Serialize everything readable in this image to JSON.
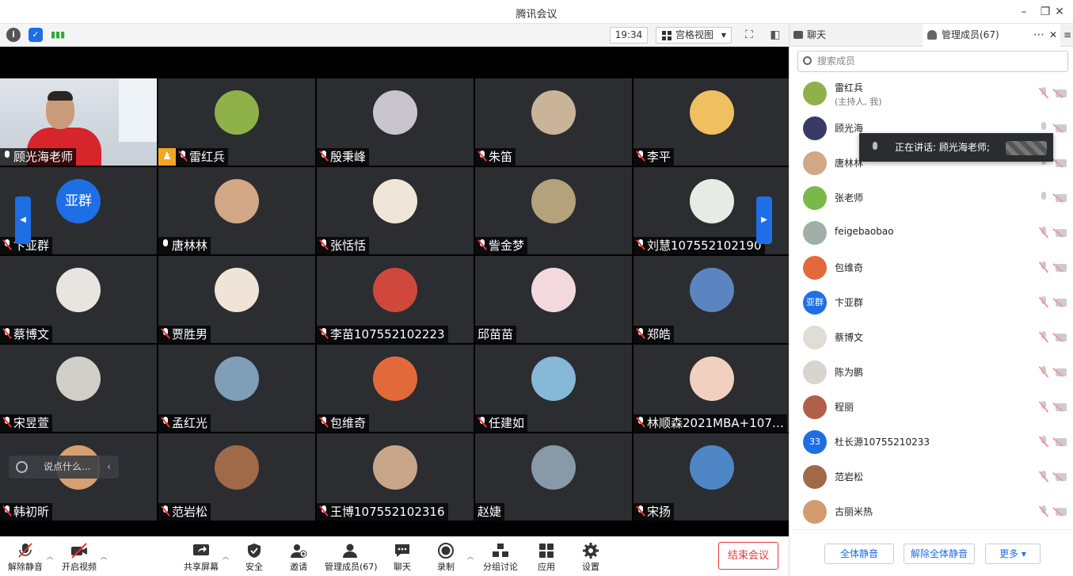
{
  "window": {
    "title": "腾讯会议"
  },
  "toolbar": {
    "clock": "19:34",
    "view_label": "宫格视图"
  },
  "panel": {
    "tab_chat": "聊天",
    "tab_members": "管理成员(67)",
    "search_placeholder": "搜索成员",
    "mute_all": "全体静音",
    "unmute_all": "解除全体静音",
    "more": "更多",
    "speaking": "正在讲话: 顾光海老师;"
  },
  "tiles": [
    {
      "name": "顾光海老师",
      "mic": "on"
    },
    {
      "name": "雷红兵",
      "mic": "muted",
      "host": true,
      "color": "#8fb14a"
    },
    {
      "name": "殷秉峰",
      "mic": "muted",
      "color": "#c8c5cf"
    },
    {
      "name": "朱笛",
      "mic": "muted",
      "color": "#c9b49a"
    },
    {
      "name": "李平",
      "mic": "muted",
      "color": "#f0c060"
    },
    {
      "name": "卞亚群",
      "mic": "muted",
      "avatar_text": "亚群",
      "color": "#1e6ee6"
    },
    {
      "name": "唐林林",
      "mic": "on",
      "color": "#d1a785"
    },
    {
      "name": "张恬恬",
      "mic": "muted",
      "color": "#f0e6d8"
    },
    {
      "name": "訾金梦",
      "mic": "muted",
      "color": "#b4a27c"
    },
    {
      "name": "刘慧107552102190",
      "mic": "muted",
      "color": "#e6ebe6"
    },
    {
      "name": "蔡博文",
      "mic": "muted",
      "color": "#e8e4e0"
    },
    {
      "name": "贾胜男",
      "mic": "muted",
      "color": "#efe4d6"
    },
    {
      "name": "李苗107552102223",
      "mic": "muted",
      "color": "#d0483c"
    },
    {
      "name": "邱苗苗",
      "mic": "none",
      "color": "#f3d9dd"
    },
    {
      "name": "郑皓",
      "mic": "muted",
      "color": "#5c84c0"
    },
    {
      "name": "宋昱萱",
      "mic": "muted",
      "color": "#cfcfc8"
    },
    {
      "name": "孟红光",
      "mic": "muted",
      "color": "#7f9fb8"
    },
    {
      "name": "包维奇",
      "mic": "muted",
      "color": "#e26a3a"
    },
    {
      "name": "任建如",
      "mic": "muted",
      "color": "#86b8d8"
    },
    {
      "name": "林顺森2021MBA+107…",
      "mic": "muted",
      "color": "#f2d0c0"
    },
    {
      "name": "韩初昕",
      "mic": "muted",
      "color": "#d6a070"
    },
    {
      "name": "范岩松",
      "mic": "muted",
      "color": "#a06a48"
    },
    {
      "name": "王博107552102316",
      "mic": "muted",
      "color": "#c9a58a"
    },
    {
      "name": "赵婕",
      "mic": "none",
      "color": "#8899a8"
    },
    {
      "name": "宋扬",
      "mic": "muted",
      "color": "#4f86c6"
    }
  ],
  "chat_input": {
    "placeholder": "说点什么..."
  },
  "members": [
    {
      "name": "雷红兵",
      "sub": "(主持人, 我)",
      "mic": "muted",
      "color": "#8fb14a"
    },
    {
      "name": "顾光海",
      "mic": "on",
      "color": "#3a3a66"
    },
    {
      "name": "唐林林",
      "mic": "on",
      "color": "#d1a785"
    },
    {
      "name": "张老师",
      "mic": "on",
      "color": "#79b84a"
    },
    {
      "name": "feigebaobao",
      "mic": "muted",
      "color": "#9fb0a8"
    },
    {
      "name": "包维奇",
      "mic": "muted",
      "color": "#e26a3a"
    },
    {
      "name": "卞亚群",
      "mic": "muted",
      "avatar_text": "亚群",
      "color": "#1e6ee6"
    },
    {
      "name": "蔡博文",
      "mic": "muted",
      "color": "#e0dcd6"
    },
    {
      "name": "陈为鹏",
      "mic": "muted",
      "color": "#d8d4ce"
    },
    {
      "name": "程丽",
      "mic": "muted",
      "color": "#b06048"
    },
    {
      "name": "杜长源10755210233",
      "mic": "muted",
      "avatar_text": "33",
      "color": "#1e6ee6"
    },
    {
      "name": "范岩松",
      "mic": "muted",
      "color": "#a06a48"
    },
    {
      "name": "古丽米热",
      "mic": "muted",
      "color": "#d49a70"
    }
  ],
  "controls": {
    "unmute": "解除静音",
    "start_video": "开启视频",
    "share": "共享屏幕",
    "security": "安全",
    "invite": "邀请",
    "members": "管理成员(67)",
    "chat": "聊天",
    "record": "录制",
    "breakout": "分组讨论",
    "apps": "应用",
    "settings": "设置",
    "end": "结束会议"
  },
  "colors": {
    "accent": "#1e6ee6",
    "danger": "#e8383d",
    "tile_bg": "#2b2d31",
    "speaker_border": "#4caf50"
  }
}
